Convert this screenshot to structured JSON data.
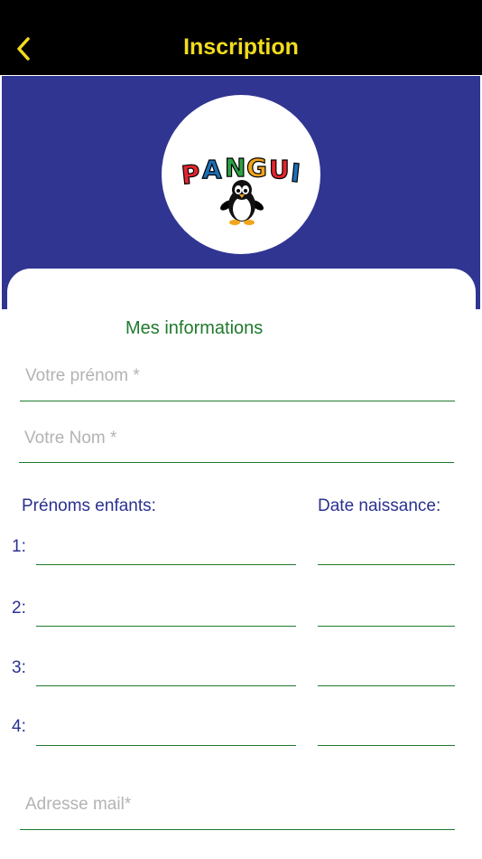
{
  "nav": {
    "title": "Inscription",
    "back_icon": "chevron-left-icon",
    "title_color": "#f2dc1c",
    "background": "#000000"
  },
  "hero": {
    "background": "#303592",
    "logo_text": "PANGUI",
    "logo_letter_colors": [
      "#e3262f",
      "#1c6fb7",
      "#2da144",
      "#f2a51c",
      "#e3262f",
      "#1c6fb7"
    ]
  },
  "form": {
    "section_title": "Mes informations",
    "prenom_placeholder": "Votre prénom *",
    "nom_placeholder": "Votre Nom *",
    "children_header": "Prénoms enfants:",
    "birthdate_header": "Date naissance:",
    "children": [
      {
        "index": "1:",
        "name": "",
        "birthdate": ""
      },
      {
        "index": "2:",
        "name": "",
        "birthdate": ""
      },
      {
        "index": "3:",
        "name": "",
        "birthdate": ""
      },
      {
        "index": "4:",
        "name": "",
        "birthdate": ""
      }
    ],
    "email_placeholder": "Adresse mail*"
  },
  "colors": {
    "accent_green": "#1f7a2d",
    "label_blue": "#2b3190"
  }
}
